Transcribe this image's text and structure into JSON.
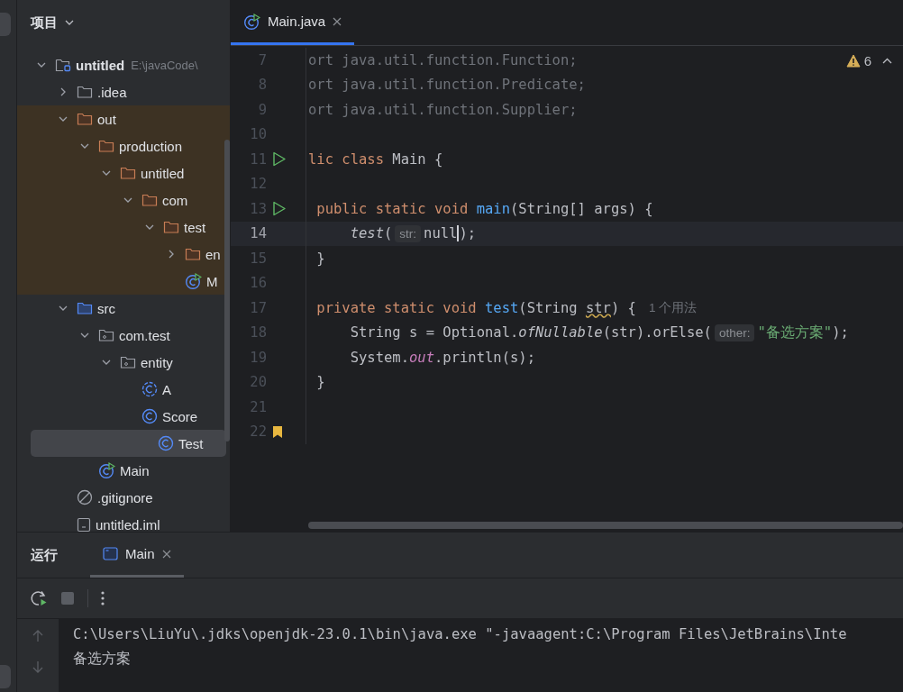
{
  "project": {
    "title": "项目",
    "tree": [
      {
        "label": "untitled",
        "path": "E:\\javaCode\\",
        "kind": "module",
        "expanded": true,
        "selected": false,
        "excluded": false,
        "children": [
          {
            "label": ".idea",
            "kind": "folder",
            "expanded": false,
            "selected": false,
            "excluded": false
          },
          {
            "label": "out",
            "kind": "folder",
            "expanded": true,
            "selected": false,
            "excluded": true,
            "children": [
              {
                "label": "production",
                "kind": "folder",
                "expanded": true,
                "selected": false,
                "excluded": true,
                "children": [
                  {
                    "label": "untitled",
                    "kind": "folder",
                    "expanded": true,
                    "selected": false,
                    "excluded": true,
                    "children": [
                      {
                        "label": "com",
                        "kind": "folder",
                        "expanded": true,
                        "selected": false,
                        "excluded": true,
                        "children": [
                          {
                            "label": "test",
                            "kind": "folder",
                            "expanded": true,
                            "selected": false,
                            "excluded": true,
                            "children": [
                              {
                                "label": "en",
                                "kind": "folder",
                                "expanded": false,
                                "selected": false,
                                "excluded": true
                              },
                              {
                                "label": "M",
                                "kind": "runnable",
                                "selected": false,
                                "excluded": true
                              }
                            ]
                          }
                        ]
                      }
                    ]
                  }
                ]
              }
            ]
          },
          {
            "label": "src",
            "kind": "source",
            "expanded": true,
            "selected": false,
            "excluded": false,
            "children": [
              {
                "label": "com.test",
                "kind": "package",
                "expanded": true,
                "selected": false,
                "excluded": false,
                "children": [
                  {
                    "label": "entity",
                    "kind": "package",
                    "expanded": true,
                    "selected": false,
                    "excluded": false,
                    "children": [
                      {
                        "label": "A",
                        "kind": "abstract",
                        "selected": false,
                        "excluded": false
                      },
                      {
                        "label": "Score",
                        "kind": "class",
                        "selected": false,
                        "excluded": false
                      },
                      {
                        "label": "Test",
                        "kind": "class",
                        "selected": true,
                        "excluded": false
                      }
                    ]
                  }
                ]
              },
              {
                "label": "Main",
                "kind": "runnable",
                "selected": false,
                "excluded": false
              }
            ]
          },
          {
            "label": ".gitignore",
            "kind": "ignore",
            "selected": false,
            "excluded": false
          },
          {
            "label": "untitled.iml",
            "kind": "file",
            "selected": false,
            "excluded": false
          }
        ]
      }
    ]
  },
  "editor": {
    "tabs": [
      {
        "label": "Main.java",
        "selected": true
      }
    ],
    "warnings": "6",
    "lines": [
      {
        "number": "7",
        "current": false,
        "tokens": [
          {
            "kind": "import",
            "text": "ort java.util.function.Function;"
          }
        ]
      },
      {
        "number": "8",
        "current": false,
        "tokens": [
          {
            "kind": "import",
            "text": "ort java.util.function.Predicate;"
          }
        ]
      },
      {
        "number": "9",
        "current": false,
        "tokens": [
          {
            "kind": "import",
            "text": "ort java.util.function.Supplier;"
          }
        ]
      },
      {
        "number": "10",
        "current": false
      },
      {
        "number": "11",
        "kind": "run",
        "current": false,
        "tokens": [
          {
            "kind": "keyword",
            "text": "lic class "
          },
          {
            "kind": "plain",
            "text": "Main {"
          }
        ]
      },
      {
        "number": "12",
        "current": false
      },
      {
        "number": "13",
        "kind": "run",
        "current": false,
        "tokens": [
          {
            "kind": "keyword",
            "text": " public static void "
          },
          {
            "kind": "method",
            "text": "main"
          },
          {
            "kind": "plain",
            "text": "(String[] args) {"
          }
        ]
      },
      {
        "number": "14",
        "current": true,
        "tokens": [
          {
            "kind": "italic",
            "text": "     test"
          },
          {
            "kind": "plain",
            "text": "("
          },
          {
            "kind": "hint",
            "text": "str:"
          },
          {
            "kind": "plain",
            "text": "null",
            "caret": true
          },
          {
            "kind": "plain",
            "text": ");"
          }
        ]
      },
      {
        "number": "15",
        "current": false,
        "tokens": [
          {
            "kind": "plain",
            "text": " }"
          }
        ]
      },
      {
        "number": "16",
        "current": false
      },
      {
        "number": "17",
        "current": false,
        "tokens": [
          {
            "kind": "keyword",
            "text": " private static void "
          },
          {
            "kind": "method",
            "text": "test"
          },
          {
            "kind": "plain",
            "text": "(String "
          },
          {
            "kind": "warn",
            "text": "str"
          },
          {
            "kind": "plain",
            "text": ") {"
          },
          {
            "kind": "usage",
            "text": "1 个用法"
          }
        ]
      },
      {
        "number": "18",
        "current": false,
        "tokens": [
          {
            "kind": "plain",
            "text": "     String s = Optional."
          },
          {
            "kind": "italic",
            "text": "ofNullable"
          },
          {
            "kind": "plain",
            "text": "(str).orElse("
          },
          {
            "kind": "hint",
            "text": "other:"
          },
          {
            "kind": "string",
            "text": "\"备选方案\""
          },
          {
            "kind": "plain",
            "text": ");"
          }
        ]
      },
      {
        "number": "19",
        "current": false,
        "tokens": [
          {
            "kind": "plain",
            "text": "     System."
          },
          {
            "kind": "field",
            "text": "out"
          },
          {
            "kind": "plain",
            "text": ".println(s);"
          }
        ]
      },
      {
        "number": "20",
        "current": false,
        "tokens": [
          {
            "kind": "plain",
            "text": " }"
          }
        ]
      },
      {
        "number": "21",
        "current": false
      },
      {
        "number": "22",
        "kind": "bookmark",
        "current": false
      }
    ]
  },
  "run_panel": {
    "title": "运行",
    "tabs": [
      {
        "label": "Main",
        "selected": true
      }
    ],
    "console": [
      "C:\\Users\\LiuYu\\.jdks\\openjdk-23.0.1\\bin\\java.exe \"-javaagent:C:\\Program Files\\JetBrains\\Inte",
      "备选方案"
    ]
  }
}
